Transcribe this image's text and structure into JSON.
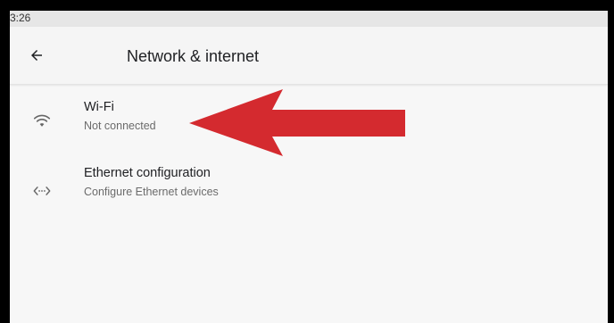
{
  "status_bar": {
    "time": "3:26"
  },
  "app_bar": {
    "title": "Network & internet",
    "back_icon": "arrow-back-icon"
  },
  "items": [
    {
      "label": "Wi-Fi",
      "summary": "Not connected",
      "icon": "wifi-icon"
    },
    {
      "label": "Ethernet configuration",
      "summary": "Configure Ethernet devices",
      "icon": "ethernet-icon"
    }
  ],
  "annotation": {
    "color": "#d42a2f",
    "points_to": "Wi-Fi"
  }
}
